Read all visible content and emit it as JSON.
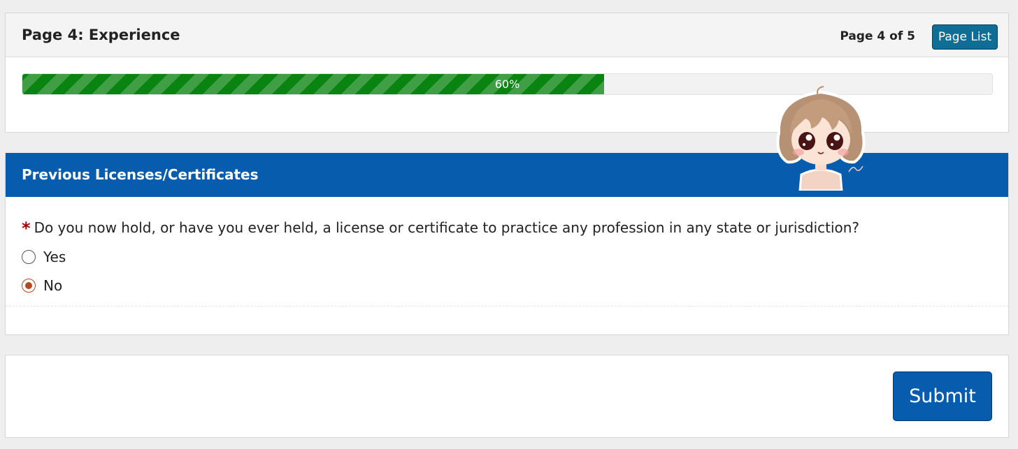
{
  "header": {
    "page_title": "Page 4: Experience",
    "page_counter": "Page 4 of 5",
    "page_list_label": "Page List"
  },
  "progress": {
    "percent": 60,
    "label": "60%",
    "fill_color": "#0a8410"
  },
  "section": {
    "title": "Previous Licenses/Certificates",
    "header_color": "#075cad",
    "question": {
      "required": true,
      "required_marker": "*",
      "text": "Do you now hold, or have you ever held, a license or certificate to practice any profession in any state or jurisdiction?",
      "options": [
        {
          "label": "Yes",
          "checked": false
        },
        {
          "label": "No",
          "checked": true
        }
      ]
    }
  },
  "footer": {
    "submit_label": "Submit"
  },
  "colors": {
    "accent_blue": "#075cad",
    "page_list_teal": "#0e6e96",
    "radio_selected": "#b04a22",
    "required_red": "#a30000"
  },
  "icons": {
    "avatar": "anime-girl-avatar-sticker"
  }
}
